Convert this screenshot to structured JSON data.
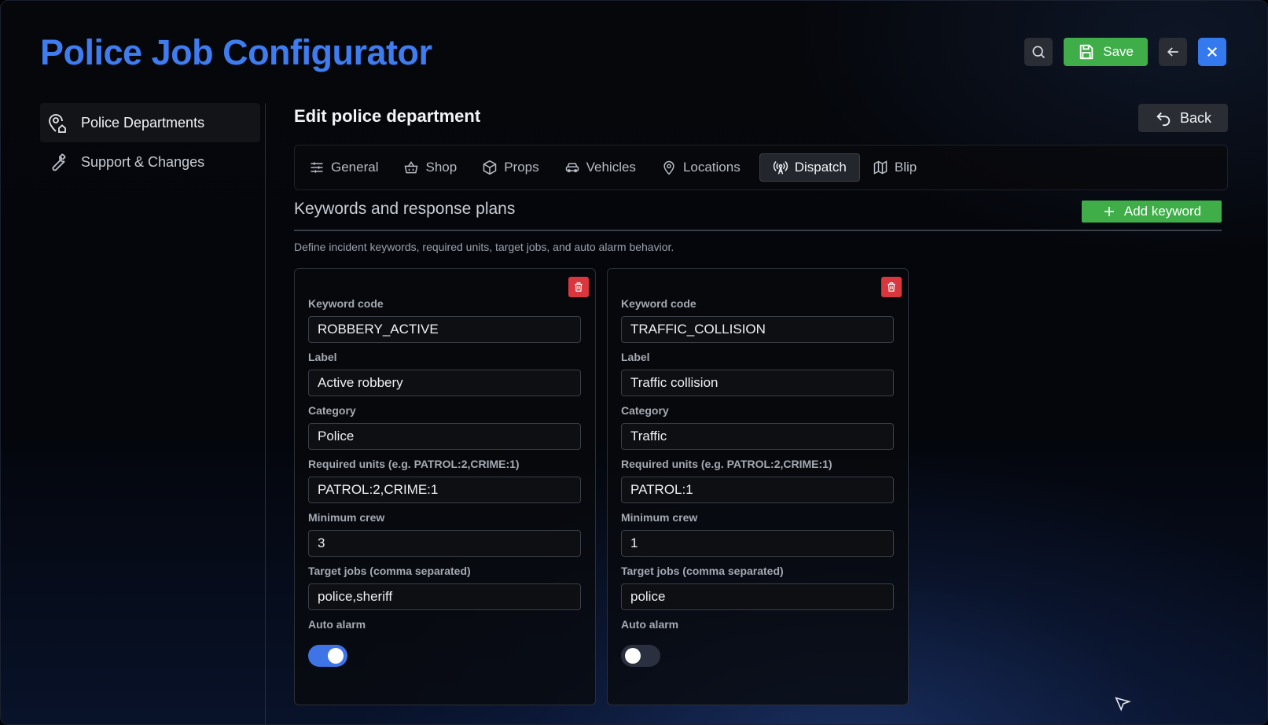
{
  "app": {
    "title": "Police Job Configurator"
  },
  "toolbar": {
    "search_icon": "search-icon",
    "save_label": "Save",
    "back_arrow_icon": "arrow-left-icon",
    "close_icon": "close-icon"
  },
  "sidebar": {
    "items": [
      {
        "label": "Police Departments",
        "icon": "map-pin-home-icon",
        "active": true
      },
      {
        "label": "Support & Changes",
        "icon": "wrench-icon",
        "active": false
      }
    ]
  },
  "main": {
    "title": "Edit police department",
    "back_label": "Back",
    "tabs": [
      {
        "label": "General",
        "icon": "sliders-icon"
      },
      {
        "label": "Shop",
        "icon": "basket-icon"
      },
      {
        "label": "Props",
        "icon": "box-icon"
      },
      {
        "label": "Vehicles",
        "icon": "car-icon"
      },
      {
        "label": "Locations",
        "icon": "map-pin-icon"
      },
      {
        "label": "Dispatch",
        "icon": "antenna-icon",
        "active": true
      },
      {
        "label": "Blip",
        "icon": "map-icon"
      }
    ],
    "section": {
      "title": "Keywords and response plans",
      "add_label": "Add keyword",
      "description": "Define incident keywords, required units, target jobs, and auto alarm behavior."
    },
    "labels": {
      "keyword_code": "Keyword code",
      "label": "Label",
      "category": "Category",
      "required_units": "Required units (e.g. PATROL:2,CRIME:1)",
      "minimum_crew": "Minimum crew",
      "target_jobs": "Target jobs (comma separated)",
      "auto_alarm": "Auto alarm"
    },
    "keywords": [
      {
        "keyword_code": "ROBBERY_ACTIVE",
        "label": "Active robbery",
        "category": "Police",
        "required_units": "PATROL:2,CRIME:1",
        "minimum_crew": "3",
        "target_jobs": "police,sheriff",
        "auto_alarm": true
      },
      {
        "keyword_code": "TRAFFIC_COLLISION",
        "label": "Traffic collision",
        "category": "Traffic",
        "required_units": "PATROL:1",
        "minimum_crew": "1",
        "target_jobs": "police",
        "auto_alarm": false
      }
    ]
  },
  "colors": {
    "accent": "#3f7cf0",
    "save_green": "#3fae49",
    "delete_red": "#d9363e",
    "toggle_on": "#3e74e6"
  }
}
